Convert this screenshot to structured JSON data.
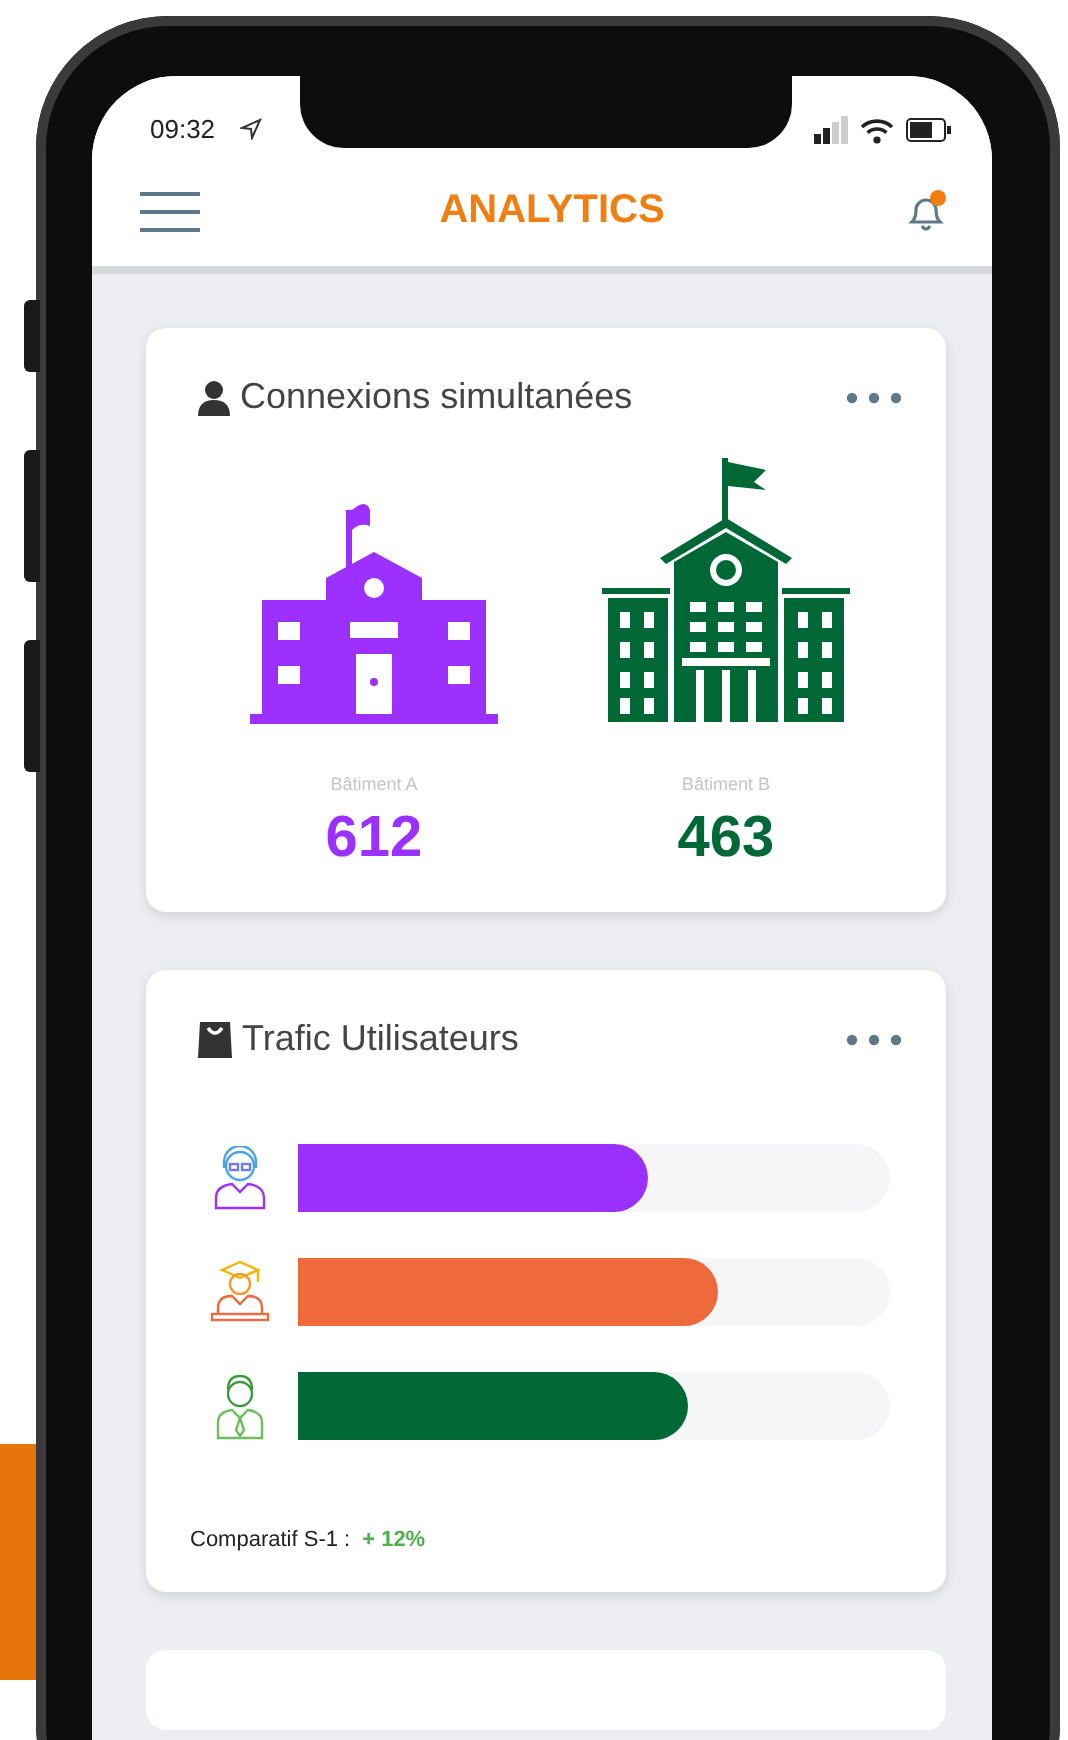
{
  "status_bar": {
    "time": "09:32"
  },
  "header": {
    "title": "ANALYTICS",
    "notification": true
  },
  "cards": [
    {
      "kind": "buildings",
      "title": "Connexions simultanées",
      "buildings": [
        {
          "kind": "small",
          "label": "Bâtiment A",
          "value": "612",
          "color": "#9b30ff"
        },
        {
          "kind": "large",
          "label": "Bâtiment B",
          "value": "463",
          "color": "#006837"
        }
      ]
    },
    {
      "kind": "bars",
      "title": "Trafic Utilisateurs",
      "bars": [
        {
          "kind": "agent",
          "level": 0.59,
          "color": "#9b30ff"
        },
        {
          "kind": "student",
          "level": 0.71,
          "color": "#ee6a3c"
        },
        {
          "kind": "employee",
          "level": 0.66,
          "color": "#006837"
        }
      ],
      "footer": {
        "label": "Comparatif S-1 :",
        "value": "+ 12%"
      }
    }
  ]
}
